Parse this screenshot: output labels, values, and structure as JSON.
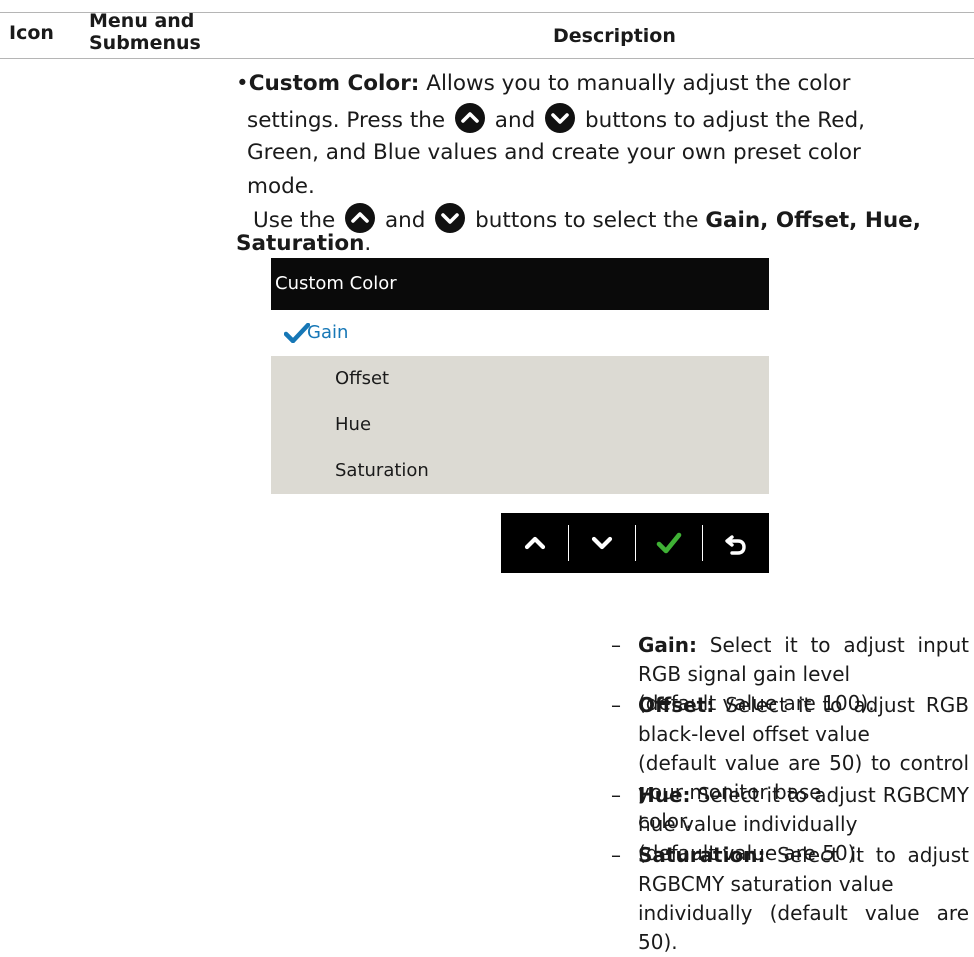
{
  "header": {
    "col_icon": "Icon",
    "col_menu_line1": "Menu and",
    "col_menu_line2": "Submenus",
    "col_description": "Description"
  },
  "intro": {
    "bullet": "•",
    "term": "Custom Color:",
    "line1_rest": " Allows you to manually adjust the color",
    "line2_a": "settings. Press the",
    "line2_b": "and",
    "line2_c": "buttons to adjust the Red,",
    "line3": "Green, and Blue values and create your own preset color",
    "line4": "mode.",
    "use_a": "Use the",
    "use_b": "and",
    "use_c": "buttons to select the",
    "use_bold": "Gain, Offset, Hue,",
    "use_bold2": "Saturation",
    "use_end": "."
  },
  "osd": {
    "title": "Custom Color",
    "options": [
      "Gain",
      "Offset",
      "Hue",
      "Saturation"
    ],
    "selected_index": 0,
    "selected_color": "#1677b6",
    "row_bg": "#dcdad3"
  },
  "navbar": {
    "buttons": [
      "chevron-up-icon",
      "chevron-down-icon",
      "checkmark-icon",
      "back-arrow-icon"
    ],
    "check_color": "#3fb135"
  },
  "items": [
    {
      "dash": "–",
      "term": "Gain:",
      "lines": [
        " Select it to adjust input RGB signal gain level",
        "(default value are 100)."
      ]
    },
    {
      "dash": "–",
      "term": "Offset:",
      "lines": [
        " Select it to adjust RGB black-level offset value",
        "(default value are 50) to control your monitor base",
        "color."
      ]
    },
    {
      "dash": "–",
      "term": "Hue:",
      "lines": [
        " Select it to adjust RGBCMY hue value individually",
        "(default value are 50)."
      ]
    },
    {
      "dash": "–",
      "term": "Saturation:",
      "lines": [
        " Select it to adjust RGBCMY saturation value",
        "individually (default value are 50)."
      ]
    }
  ]
}
